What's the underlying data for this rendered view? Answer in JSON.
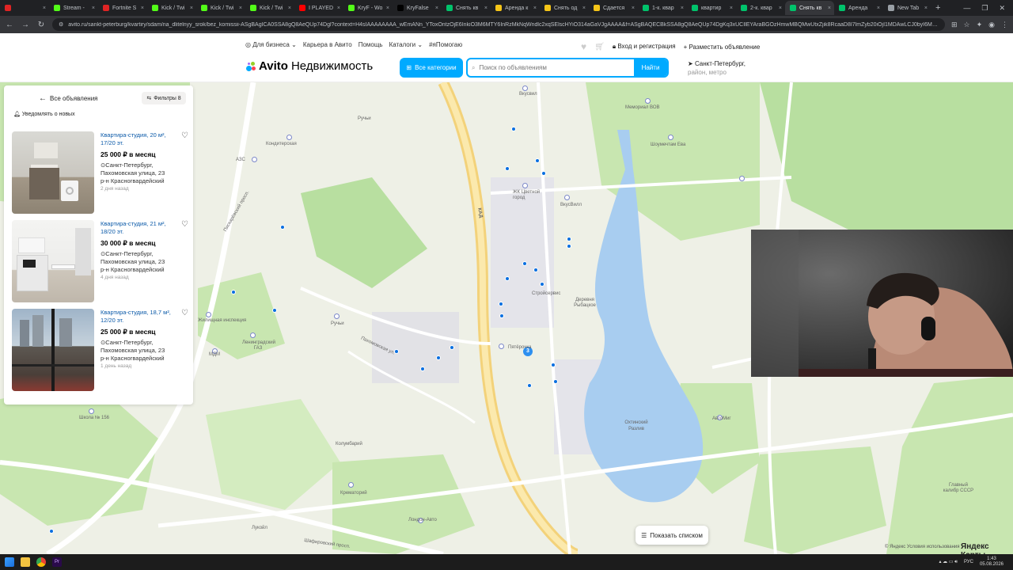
{
  "browser": {
    "tabs": [
      {
        "title": "",
        "color": "#e02424"
      },
      {
        "title": "Stream -",
        "color": "#53fc18"
      },
      {
        "title": "Fortnite S",
        "color": "#e02424"
      },
      {
        "title": "Kick / Twi",
        "color": "#53fc18"
      },
      {
        "title": "Kick / Twi",
        "color": "#53fc18"
      },
      {
        "title": "Kick / Twi",
        "color": "#53fc18"
      },
      {
        "title": "I PLAYED",
        "color": "#ff0000"
      },
      {
        "title": "KryF - Wo",
        "color": "#53fc18"
      },
      {
        "title": "KryFalse",
        "color": "#000000"
      },
      {
        "title": "Снять кв",
        "color": "#00c36b"
      },
      {
        "title": "Аренда к",
        "color": "#f5c518"
      },
      {
        "title": "Снять од",
        "color": "#f5c518"
      },
      {
        "title": "Сдается",
        "color": "#f5c518"
      },
      {
        "title": "1-к. квар",
        "color": "#00c36b"
      },
      {
        "title": "квартир",
        "color": "#00c36b"
      },
      {
        "title": "2-к. квар",
        "color": "#00c36b"
      },
      {
        "title": "Снять кв",
        "color": "#00c36b",
        "active": true
      },
      {
        "title": "Аренда",
        "color": "#00c36b"
      },
      {
        "title": "New Tab",
        "color": "#9aa0a6"
      }
    ],
    "url": "avito.ru/sankt-peterburg/kvartiry/sdam/na_dlitelnyy_srok/bez_komissii-ASgBAgICA0SSA8gQ8AeQUp74Dgl?context=H4sIAAAAAAAA_wEmANn_YToxOntzOjE6InkiO3M6MTY6InRzMkNqWndlc2xqSElscHYiO314aGaVJgAAAA&f=ASgBAQECBkSSA8gQ8AeQUp74DgKq3xUCIlEYAraBGOzHmwMBQMwUtxZjik8RcaaD8I7lmZyb20iOjI1MDAwLCJ0byI6MzUw..."
  },
  "header": {
    "links": [
      "Для бизнеса",
      "Карьера в Авито",
      "Помощь",
      "Каталоги",
      "#яПомогаю"
    ],
    "login": "Вход и регистрация",
    "post_ad": "Разместить объявление",
    "logo_brand": "Avito",
    "logo_sub": "Недвижимость",
    "categories_btn": "Все категории",
    "search_placeholder": "Поиск по объявлениям",
    "find_btn": "Найти",
    "city": "Санкт-Петербург,",
    "city_sub": "район, метро"
  },
  "sidebar": {
    "back": "Все объявления",
    "filters": "Фильтры 8",
    "notify": "Уведомлять о новых",
    "listings": [
      {
        "title": "Квартира-студия, 20 м², 17/20 эт.",
        "price": "25 000 ₽ в месяц",
        "city": "Санкт-Петербург,",
        "street": "Пахомовская улица, 23",
        "district": "р-н Красногвардейский",
        "date": "2 дня назад"
      },
      {
        "title": "Квартира-студия, 21 м², 18/20 эт.",
        "price": "30 000 ₽ в месяц",
        "city": "Санкт-Петербург,",
        "street": "Пахомовская улица, 23",
        "district": "р-н Красногвардейский",
        "date": "4 дня назад"
      },
      {
        "title": "Квартира-студия, 18,7 м², 12/20 эт.",
        "price": "25 000 ₽ в месяц",
        "city": "Санкт-Петербург,",
        "street": "Пахомовская улица, 23",
        "district": "р-н Красногвардейский",
        "date": "1 день назад"
      }
    ]
  },
  "map": {
    "labels": [
      {
        "text": "Кондитерская",
        "name": "label-konditerskaya"
      },
      {
        "text": "АЗС",
        "name": "label-azs"
      },
      {
        "text": "Ручьи",
        "name": "label-ruchi"
      },
      {
        "text": "Вкусвил",
        "name": "label-vkusvill"
      },
      {
        "text": "Мемориал ВОВ",
        "name": "label-memorial"
      },
      {
        "text": "Шоумечтам Ева",
        "name": "label-show"
      },
      {
        "text": "ЖК Цветной город",
        "name": "label-zhk"
      },
      {
        "text": "ВкусВилл",
        "name": "label-vkusvill2"
      },
      {
        "text": "Ленинградский ГАЗ",
        "name": "label-gaz"
      },
      {
        "text": "Ручьи",
        "name": "label-ruchi2"
      },
      {
        "text": "МДМ",
        "name": "label-mdm"
      },
      {
        "text": "Пятёрочка",
        "name": "label-pyaterochka"
      },
      {
        "text": "Деревня Рыбацкое",
        "name": "label-village"
      },
      {
        "text": "Жилищная инспекция",
        "name": "label-inspection"
      },
      {
        "text": "Охтинский Разлив",
        "name": "label-razliv"
      },
      {
        "text": "Школа № 156",
        "name": "label-school"
      },
      {
        "text": "Колумбарий",
        "name": "label-columbarium"
      },
      {
        "text": "Крематорий",
        "name": "label-crematorium"
      },
      {
        "text": "Лукойл",
        "name": "label-lukoil"
      },
      {
        "text": "Лондон-Авто",
        "name": "label-london"
      },
      {
        "text": "Главный калибр СССР",
        "name": "label-caliber"
      },
      {
        "text": "АвтоМиг",
        "name": "label-avtomig"
      },
      {
        "text": "Пахомовская ул.",
        "name": "label-pakhomovskaya"
      },
      {
        "text": "КАД",
        "name": "label-kad"
      },
      {
        "text": "Шафировский просп.",
        "name": "label-shafirovsky"
      },
      {
        "text": "Пискарёвский просп.",
        "name": "label-piskarevsky"
      },
      {
        "text": "Стройсервис",
        "name": "label-stroy"
      }
    ],
    "cluster_count": "3",
    "show_list": "Показать списком",
    "copyright": "© Яндекс Условия использования",
    "ymaps": "Яндекс Карты"
  },
  "taskbar": {
    "lang": "РУС",
    "time": "1:43",
    "date": "05.08.2026"
  }
}
